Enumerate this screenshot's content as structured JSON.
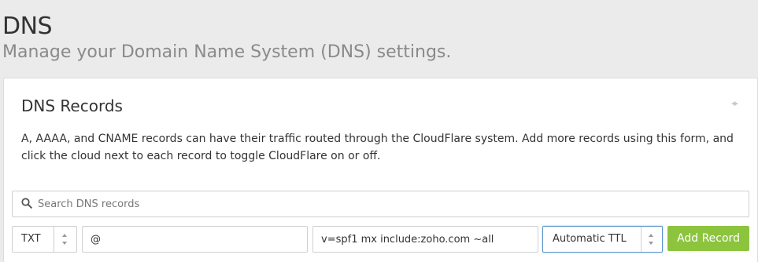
{
  "header": {
    "title": "DNS",
    "subtitle": "Manage your Domain Name System (DNS) settings."
  },
  "card": {
    "title": "DNS Records",
    "description": "A, AAAA, and CNAME records can have their traffic routed through the CloudFlare system. Add more records using this form, and click the cloud next to each record to toggle CloudFlare on or off."
  },
  "search": {
    "placeholder": "Search DNS records",
    "icon": "search-icon"
  },
  "record_form": {
    "type": "TXT",
    "name": "@",
    "content": "v=spf1 mx include:zoho.com ~all",
    "ttl": "Automatic TTL",
    "add_label": "Add Record"
  },
  "colors": {
    "accent_green": "#8cc43e",
    "focus_blue": "#5b95c9",
    "background": "#ebebeb"
  }
}
